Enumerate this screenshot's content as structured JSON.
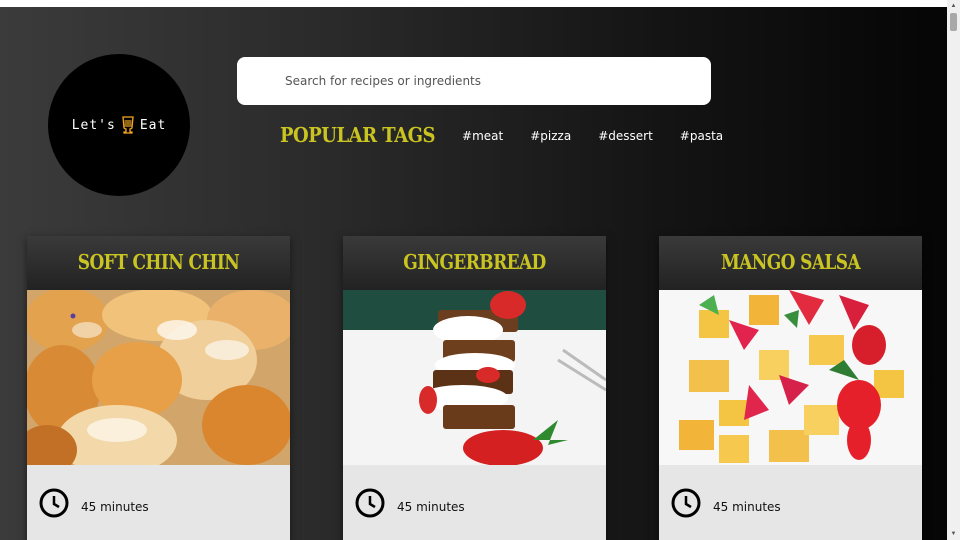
{
  "brand": {
    "text_left": "Let's",
    "text_right": "Eat",
    "icon": "beer-glass-icon",
    "accent": "#f5a623"
  },
  "search": {
    "placeholder": "Search for recipes or ingredients",
    "value": ""
  },
  "tags": {
    "title": "POPULAR TAGS",
    "items": [
      "#meat",
      "#pizza",
      "#dessert",
      "#pasta"
    ]
  },
  "recipes": [
    {
      "title": "SOFT CHIN CHIN",
      "time": "45 minutes",
      "icon": "clock-icon"
    },
    {
      "title": "GINGERBREAD",
      "time": "45 minutes",
      "icon": "clock-icon"
    },
    {
      "title": "MANGO SALSA",
      "time": "45 minutes",
      "icon": "clock-icon"
    }
  ],
  "colors": {
    "title_yellow": "#c9c421",
    "card_bg": "#e6e6e6"
  }
}
